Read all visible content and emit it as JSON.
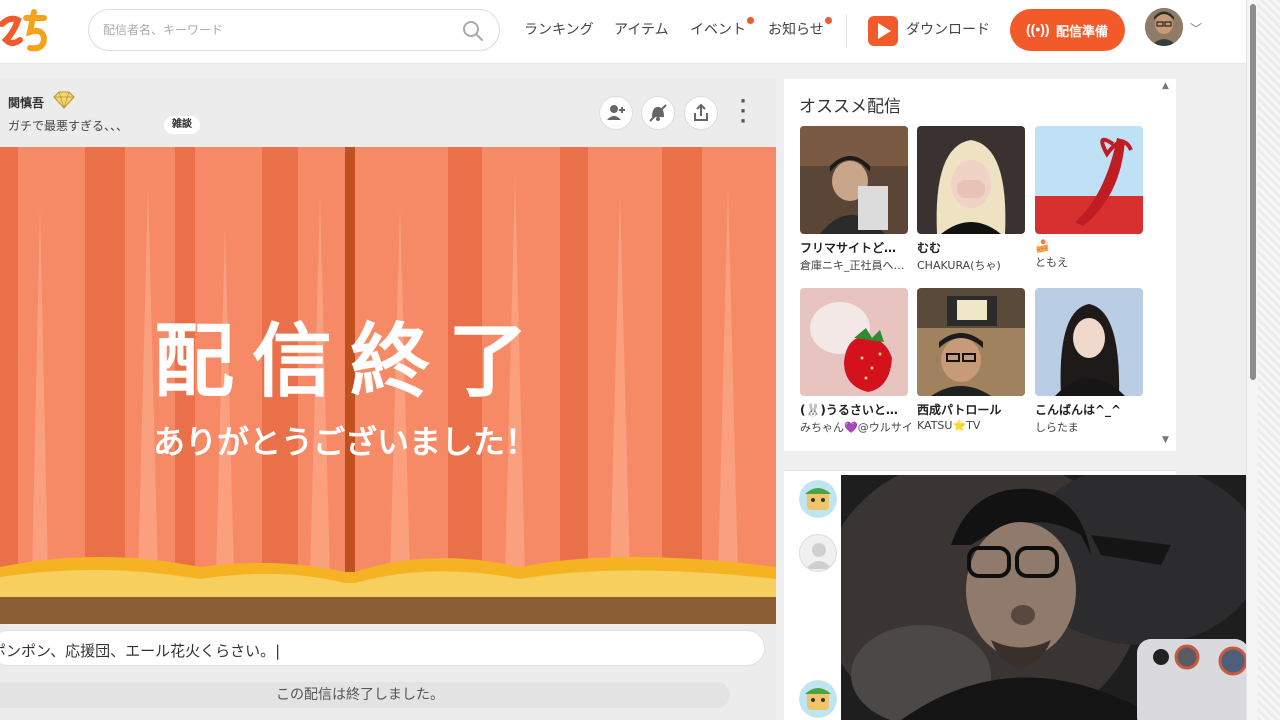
{
  "header": {
    "search_placeholder": "配信者名、キーワード",
    "nav": [
      {
        "label": "ランキング",
        "has_dot": false
      },
      {
        "label": "アイテム",
        "has_dot": false
      },
      {
        "label": "イベント",
        "has_dot": true
      },
      {
        "label": "お知らせ",
        "has_dot": true
      }
    ],
    "download_label": "ダウンロード",
    "broadcast_label": "配信準備"
  },
  "stream": {
    "streamer_name": "関慎吾",
    "title": "ガチで最悪すぎる、、、",
    "tag": "雑談",
    "end_main": "配信終了",
    "end_sub": "ありがとうございました！",
    "comment_text": "ポンポン、応援団、エール花火くらさい。|",
    "ended_notice": "この配信は終了しました。"
  },
  "recommend": {
    "title": "オススメ配信",
    "cards": [
      {
        "name": "フリマサイトど…",
        "sub": "倉庫ニキ_正社員へ…"
      },
      {
        "name": "むむ",
        "sub": "CHAKURA(ちゃ)"
      },
      {
        "name": "🍰",
        "sub": "ともえ"
      },
      {
        "name": "(🐰)うるさいと…",
        "sub": "みちゃん💜@ウルサイ…"
      },
      {
        "name": "西成パトロール",
        "sub": "KATSU⭐TV"
      },
      {
        "name": "こんばんは^_^",
        "sub": "しらたま"
      }
    ]
  },
  "colors": {
    "accent": "#f25a2a",
    "curtain": "#f78a66",
    "curtain_dark": "#e97049",
    "stage_gold": "#f5b324",
    "stage_floor": "#8b5e34"
  },
  "icons": [
    "search-icon",
    "add-user-icon",
    "mute-icon",
    "share-icon",
    "more-icon",
    "broadcast-icon",
    "download-app-icon",
    "chevron-down-icon",
    "gem-icon",
    "default-avatar-icon"
  ]
}
